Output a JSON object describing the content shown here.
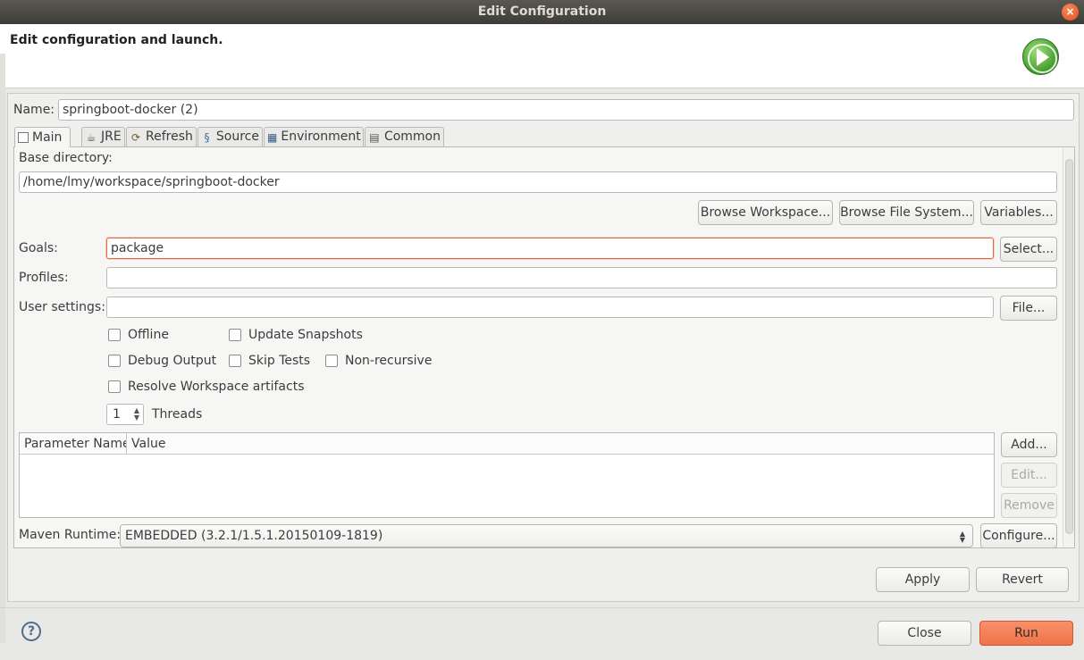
{
  "window": {
    "title": "Edit Configuration",
    "close_glyph": "×"
  },
  "header": {
    "title": "Edit configuration and launch.",
    "icon": "run-launch-icon"
  },
  "name": {
    "label": "Name:",
    "value": "springboot-docker (2)"
  },
  "tabs": [
    {
      "label": "Main",
      "icon": "main-tab-icon",
      "active": true
    },
    {
      "label": "JRE",
      "icon": "jre-icon",
      "active": false
    },
    {
      "label": "Refresh",
      "icon": "refresh-icon",
      "active": false
    },
    {
      "label": "Source",
      "icon": "source-icon",
      "active": false
    },
    {
      "label": "Environment",
      "icon": "environment-icon",
      "active": false
    },
    {
      "label": "Common",
      "icon": "common-icon",
      "active": false
    }
  ],
  "main": {
    "base_directory": {
      "label": "Base directory:",
      "value": "/home/lmy/workspace/springboot-docker",
      "browse_workspace": "Browse Workspace...",
      "browse_filesystem": "Browse File System...",
      "variables": "Variables..."
    },
    "goals": {
      "label": "Goals:",
      "value": "package",
      "select": "Select..."
    },
    "profiles": {
      "label": "Profiles:",
      "value": ""
    },
    "user_settings": {
      "label": "User settings:",
      "value": "",
      "file": "File..."
    },
    "options": {
      "offline": {
        "label": "Offline",
        "checked": false
      },
      "update_snapshots": {
        "label": "Update Snapshots",
        "checked": false
      },
      "debug_output": {
        "label": "Debug Output",
        "checked": false
      },
      "skip_tests": {
        "label": "Skip Tests",
        "checked": false
      },
      "non_recursive": {
        "label": "Non-recursive",
        "checked": false
      },
      "resolve_workspace": {
        "label": "Resolve Workspace artifacts",
        "checked": false
      }
    },
    "threads": {
      "value": "1",
      "label": "Threads"
    },
    "parameters": {
      "columns": [
        "Parameter Name",
        "Value"
      ],
      "rows": [],
      "add": "Add...",
      "edit": "Edit...",
      "remove": "Remove"
    },
    "maven_runtime": {
      "label": "Maven Runtime:",
      "value": "EMBEDDED (3.2.1/1.5.1.20150109-1819)",
      "configure": "Configure..."
    }
  },
  "actions": {
    "apply": "Apply",
    "revert": "Revert",
    "close": "Close",
    "run": "Run"
  },
  "colors": {
    "accent": "#ef7348",
    "focus_border": "#e9673a",
    "titlebar": "#3e3c37"
  }
}
